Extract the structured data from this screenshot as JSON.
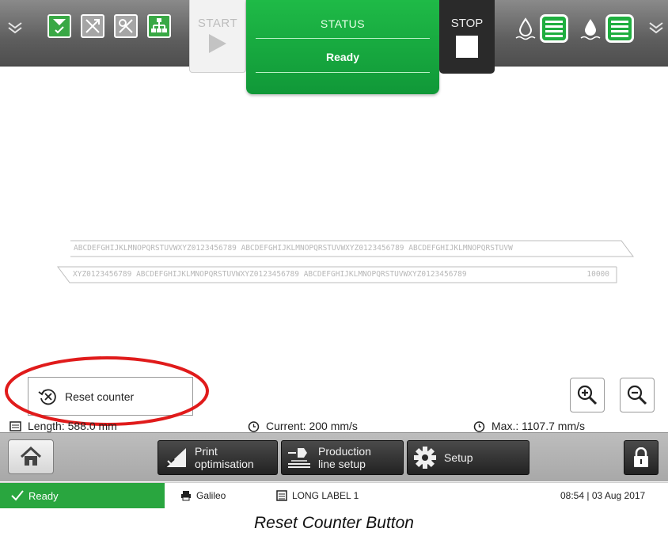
{
  "top_bar": {
    "start_label": "START",
    "status_title": "STATUS",
    "status_value": "Ready",
    "stop_label": "STOP",
    "left_icons": [
      "job-select-icon",
      "fault-disabled-icon",
      "tools-disabled-icon",
      "network-icon"
    ],
    "right_icons": [
      "solvent-level-icon",
      "solvent-gauge-icon",
      "ink-level-icon",
      "ink-gauge-icon"
    ],
    "colors": {
      "status_green": "#18a83f",
      "stop_dark": "#2a2a2a",
      "bar_grey": "#6b6b6b"
    }
  },
  "label_preview": {
    "top_text": "ABCDEFGHIJKLMNOPQRSTUVWXYZ0123456789 ABCDEFGHIJKLMNOPQRSTUVWXYZ0123456789 ABCDEFGHIJKLMNOPQRSTUVW",
    "bottom_text": "XYZ0123456789 ABCDEFGHIJKLMNOPQRSTUVWXYZ0123456789 ABCDEFGHIJKLMNOPQRSTUVWXYZ0123456789",
    "counter": "10000"
  },
  "reset_counter": {
    "label": "Reset counter"
  },
  "zoom": {
    "zoom_in": "zoom-in-icon",
    "zoom_out": "zoom-out-icon"
  },
  "info_row": {
    "length": "Length: 588.0 mm",
    "current_speed": "Current: 200 mm/s",
    "max_speed": "Max.: 1107.7 mm/s"
  },
  "nav": {
    "print_optimisation_line1": "Print",
    "print_optimisation_line2": "optimisation",
    "production_line1": "Production",
    "production_line2": "line setup",
    "setup": "Setup"
  },
  "status_bar": {
    "state": "Ready",
    "printer": "Galileo",
    "job": "LONG LABEL 1",
    "datetime": "08:54 | 03 Aug 2017"
  },
  "caption": "Reset Counter Button"
}
